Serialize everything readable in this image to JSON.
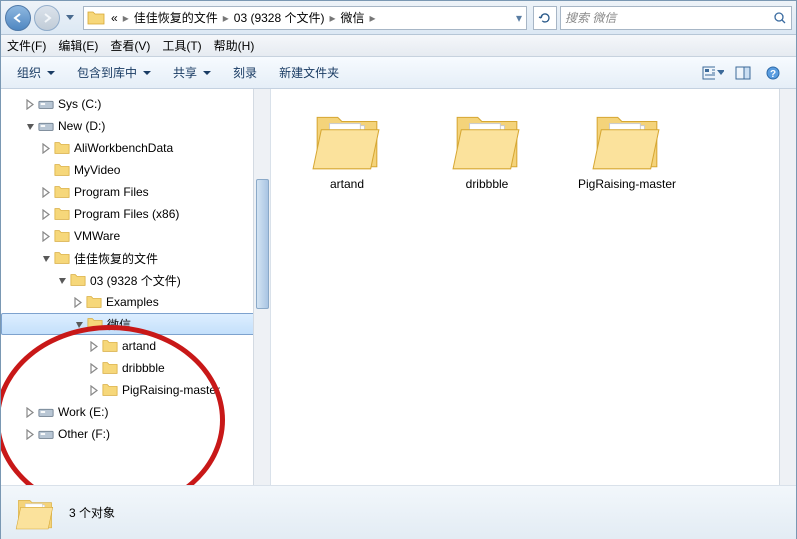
{
  "nav": {
    "breadcrumb": {
      "overflow": "«",
      "parts": [
        "佳佳恢复的文件",
        "03   (9328 个文件)",
        "微信"
      ]
    },
    "search_placeholder": "搜索 微信"
  },
  "menu": {
    "file": "文件(F)",
    "edit": "编辑(E)",
    "view": "查看(V)",
    "tools": "工具(T)",
    "help": "帮助(H)"
  },
  "toolbar": {
    "organize": "组织",
    "include": "包含到库中",
    "share": "共享",
    "burn": "刻录",
    "newfolder": "新建文件夹"
  },
  "tree": {
    "items": [
      {
        "level": 2,
        "twist": "closed",
        "icon": "drive",
        "label": "Sys (C:)"
      },
      {
        "level": 2,
        "twist": "open",
        "icon": "drive",
        "label": "New (D:)"
      },
      {
        "level": 3,
        "twist": "closed",
        "icon": "folder",
        "label": "AliWorkbenchData"
      },
      {
        "level": 3,
        "twist": "none",
        "icon": "folder",
        "label": "MyVideo"
      },
      {
        "level": 3,
        "twist": "closed",
        "icon": "folder",
        "label": "Program Files"
      },
      {
        "level": 3,
        "twist": "closed",
        "icon": "folder",
        "label": "Program Files (x86)"
      },
      {
        "level": 3,
        "twist": "closed",
        "icon": "folder",
        "label": "VMWare"
      },
      {
        "level": 3,
        "twist": "open",
        "icon": "folder",
        "label": "佳佳恢复的文件"
      },
      {
        "level": 4,
        "twist": "open",
        "icon": "folder",
        "label": "03   (9328 个文件)"
      },
      {
        "level": 5,
        "twist": "closed",
        "icon": "folder",
        "label": "Examples"
      },
      {
        "level": 5,
        "twist": "open",
        "icon": "folder",
        "label": "微信",
        "selected": true
      },
      {
        "level": 6,
        "twist": "closed",
        "icon": "folder",
        "label": "artand",
        "ind": 5
      },
      {
        "level": 6,
        "twist": "closed",
        "icon": "folder",
        "label": "dribbble",
        "ind": 5
      },
      {
        "level": 6,
        "twist": "closed",
        "icon": "folder",
        "label": "PigRaising-master",
        "ind": 5
      },
      {
        "level": 2,
        "twist": "closed",
        "icon": "drive",
        "label": "Work (E:)"
      },
      {
        "level": 2,
        "twist": "closed",
        "icon": "drive",
        "label": "Other (F:)"
      }
    ]
  },
  "main": {
    "folders": [
      "artand",
      "dribbble",
      "PigRaising-master"
    ]
  },
  "status": {
    "text": "3 个对象"
  }
}
